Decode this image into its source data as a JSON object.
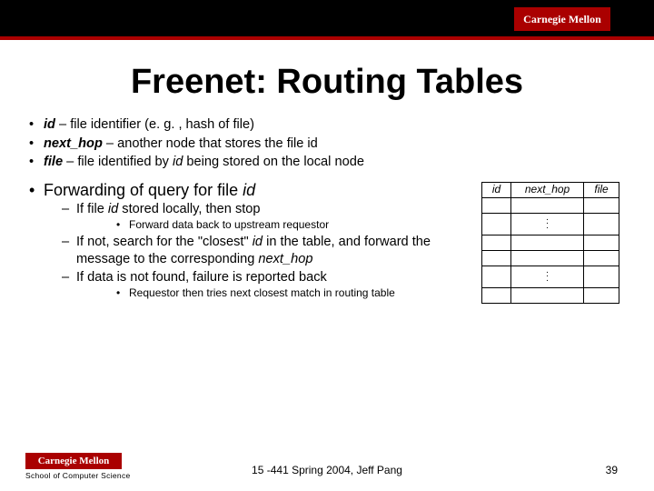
{
  "header": {
    "logo": "Carnegie Mellon"
  },
  "title": "Freenet: Routing Tables",
  "defs": {
    "id_term": "id",
    "id_text": " – file identifier (e. g. , hash of file)",
    "nh_term": "next_hop",
    "nh_text": " – another node that stores the file id",
    "file_term": "file",
    "file_pre": " – file identified by ",
    "file_mid": "id",
    "file_post": " being stored on the local node"
  },
  "fwd": {
    "lead_pre": "Forwarding of query for file ",
    "lead_id": "id",
    "s1_pre": "If file ",
    "s1_id": "id",
    "s1_post": " stored locally, then stop",
    "s1a": "Forward data back to upstream requestor",
    "s2_pre": "If not, search for the \"closest\" ",
    "s2_id": "id",
    "s2_mid": " in the table, and forward the message to the corresponding ",
    "s2_nh": "next_hop",
    "s3": "If data is not found, failure is reported back",
    "s3a": "Requestor then tries next closest match in routing table"
  },
  "table": {
    "h1": "id",
    "h2": "next_hop",
    "h3": "file"
  },
  "footer": {
    "logo": "Carnegie Mellon",
    "scs": "School of Computer Science",
    "mid": "15 -441 Spring 2004, Jeff Pang",
    "num": "39"
  }
}
